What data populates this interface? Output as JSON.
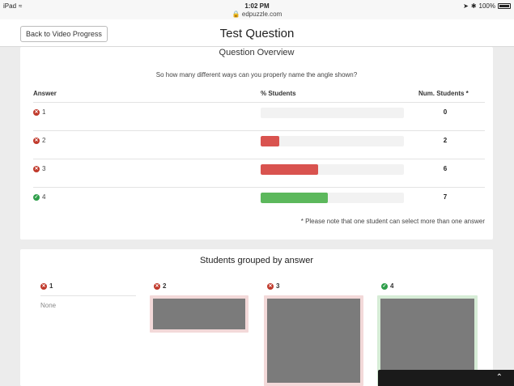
{
  "status": {
    "device": "iPad",
    "time": "1:02 PM",
    "url": "edpuzzle.com",
    "battery": "100%"
  },
  "header": {
    "back_label": "Back to Video Progress",
    "title": "Test Question"
  },
  "overview": {
    "heading": "Question Overview",
    "question": "So how many different ways can you properly name the angle shown?",
    "columns": {
      "answer": "Answer",
      "pct": "% Students",
      "num": "Num. Students *"
    },
    "rows": [
      {
        "answer": "1",
        "correct": false,
        "count": "0",
        "fraction": 0.0,
        "color": "#d9534f"
      },
      {
        "answer": "2",
        "correct": false,
        "count": "2",
        "fraction": 0.13,
        "color": "#d9534f"
      },
      {
        "answer": "3",
        "correct": false,
        "count": "6",
        "fraction": 0.4,
        "color": "#d9534f"
      },
      {
        "answer": "4",
        "correct": true,
        "count": "7",
        "fraction": 0.47,
        "color": "#5cb85c"
      }
    ],
    "note": "* Please note that one student can select more than one answer"
  },
  "grouped": {
    "heading": "Students grouped by answer",
    "groups": [
      {
        "answer": "1",
        "correct": false,
        "none_label": "None"
      },
      {
        "answer": "2",
        "correct": false
      },
      {
        "answer": "3",
        "correct": false
      },
      {
        "answer": "4",
        "correct": true
      }
    ]
  },
  "icons": {
    "wrong": "x-circle-icon",
    "right": "check-circle-icon"
  }
}
